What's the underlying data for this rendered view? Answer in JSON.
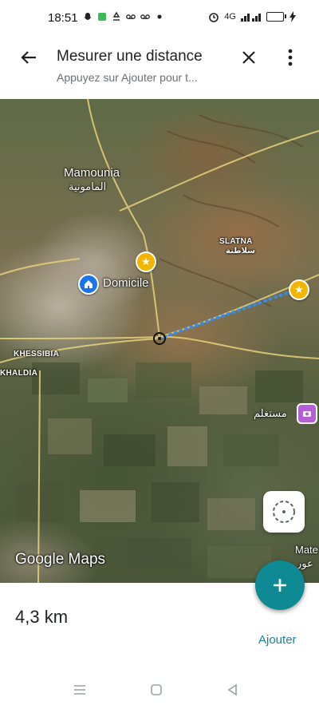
{
  "status_bar": {
    "time": "18:51",
    "network": "4G",
    "left_icons": [
      "snapchat-icon",
      "app-icon",
      "recycle-icon",
      "voicemail-icon",
      "voicemail-icon",
      "dot-icon"
    ],
    "right_icons": [
      "alarm-icon",
      "signal-icon",
      "battery-icon",
      "charging-icon"
    ]
  },
  "header": {
    "title": "Mesurer une distance",
    "subtitle": "Appuyez sur Ajouter pour t..."
  },
  "map": {
    "places": {
      "mamounia": "Mamounia",
      "mamounia_ar": "المامونية",
      "domicile": "Domicile",
      "slatna": "SLATNA",
      "slatna_ar": "سلاطنة",
      "khessibia": "KHESSIBIA",
      "khaldia": "KHALDIA",
      "mechghal": "مستغلم",
      "mate": "Mate",
      "mate_ar": "عور"
    },
    "attribution": "Google Maps",
    "measure_line_color": "#2f8ef0"
  },
  "bottom_sheet": {
    "distance": "4,3 km",
    "add_label": "Ajouter"
  },
  "fab_icon": "plus-icon"
}
